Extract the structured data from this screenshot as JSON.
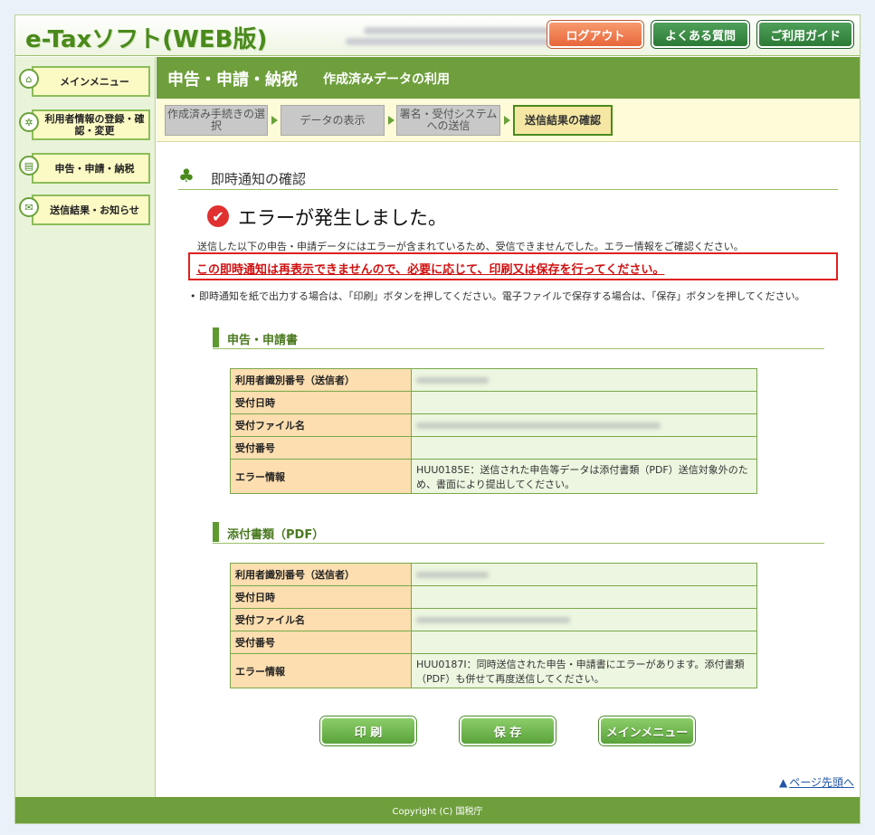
{
  "header": {
    "logo": "e-Taxソフト(WEB版)",
    "logout_label": "ログアウト",
    "faq_label": "よくある質問",
    "guide_label": "ご利用ガイド"
  },
  "sidebar": {
    "items": [
      {
        "label": "メインメニュー",
        "icon": "home-icon"
      },
      {
        "label": "利用者情報の登録・確認・変更",
        "icon": "user-settings-icon"
      },
      {
        "label": "申告・申請・納税",
        "icon": "document-icon"
      },
      {
        "label": "送信結果・お知らせ",
        "icon": "mail-icon"
      }
    ]
  },
  "title_bar": {
    "main": "申告・申請・納税",
    "sub": "作成済みデータの利用"
  },
  "steps": [
    {
      "label": "作成済み手続きの選択",
      "active": false
    },
    {
      "label": "データの表示",
      "active": false
    },
    {
      "label": "署名・受付システムへの送信",
      "active": false
    },
    {
      "label": "送信結果の確認",
      "active": true
    }
  ],
  "section": {
    "heading": "即時通知の確認",
    "error_title": "エラーが発生しました。",
    "message": "送信した以下の申告・申請データにはエラーが含まれているため、受信できませんでした。エラー情報をご確認ください。",
    "warning": "この即時通知は再表示できませんので、必要に応じて、印刷又は保存を行ってください。",
    "note": "即時通知を紙で出力する場合は、「印刷」ボタンを押してください。電子ファイルで保存する場合は、「保存」ボタンを押してください。"
  },
  "tables": [
    {
      "heading": "申告・申請書",
      "rows": [
        {
          "label": "利用者識別番号（送信者）",
          "value": ""
        },
        {
          "label": "受付日時",
          "value": ""
        },
        {
          "label": "受付ファイル名",
          "value": ""
        },
        {
          "label": "受付番号",
          "value": ""
        },
        {
          "label": "エラー情報",
          "value": "HUU0185E：送信された申告等データは添付書類（PDF）送信対象外のため、書面により提出してください。"
        }
      ]
    },
    {
      "heading": "添付書類（PDF）",
      "rows": [
        {
          "label": "利用者識別番号（送信者）",
          "value": ""
        },
        {
          "label": "受付日時",
          "value": ""
        },
        {
          "label": "受付ファイル名",
          "value": ""
        },
        {
          "label": "受付番号",
          "value": ""
        },
        {
          "label": "エラー情報",
          "value": "HUU0187I：同時送信された申告・申請書にエラーがあります。添付書類（PDF）も併せて再度送信してください。"
        }
      ]
    }
  ],
  "buttons": {
    "print": "印 刷",
    "save": "保 存",
    "menu": "メインメニュー"
  },
  "page_top": "ページ先頭へ",
  "footer": "Copyright (C) 国税庁"
}
